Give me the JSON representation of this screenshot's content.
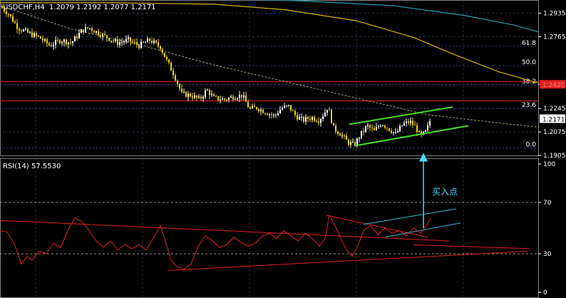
{
  "main_header": {
    "symbol": "USDCHF,H4",
    "ohlc": "1.2079 1.2192 1.2077 1.2171"
  },
  "rsi_header": {
    "label": "RSI(14) 57.5530"
  },
  "annotation": {
    "buy_point": "买入点"
  },
  "colors": {
    "background": "#000000",
    "grid": "#3a4a6a",
    "up_candle": "#ffffff",
    "down_candle": "#f0d000",
    "ma_fast": "#a8a070",
    "ma_mid": "#d4b400",
    "ma_slow": "#20a0b0",
    "red_lines": "#e02020",
    "channel_green": "#40e020",
    "channel_cyan": "#30b8e0",
    "rsi_line": "#e02020",
    "arrow": "#40e0ff",
    "current_price_box": "#ffffff",
    "level_box": "#e02020"
  },
  "chart_data": [
    {
      "type": "candlestick",
      "title": "USDCHF,H4",
      "ylim": [
        1.1905,
        1.302
      ],
      "y_ticks": [
        "1.2935",
        "1.2765",
        "1.2420",
        "1.2245",
        "1.2075",
        "1.1905"
      ],
      "current_price": "1.2171",
      "highlighted_level": "1.2420",
      "fib_levels": [
        {
          "label": "61.8",
          "value": 1.2695
        },
        {
          "label": "50.0",
          "value": 1.2555
        },
        {
          "label": "38.2",
          "value": 1.2415
        },
        {
          "label": "23.6",
          "value": 1.2245
        },
        {
          "label": "0.0",
          "value": 1.196
        }
      ],
      "horizontal_lines": [
        1.244,
        1.23
      ],
      "close_path": [
        [
          0,
          1.2985
        ],
        [
          12,
          1.293
        ],
        [
          25,
          1.283
        ],
        [
          40,
          1.279
        ],
        [
          55,
          1.276
        ],
        [
          70,
          1.27
        ],
        [
          85,
          1.274
        ],
        [
          100,
          1.272
        ],
        [
          115,
          1.281
        ],
        [
          125,
          1.283
        ],
        [
          135,
          1.28
        ],
        [
          150,
          1.276
        ],
        [
          165,
          1.272
        ],
        [
          180,
          1.274
        ],
        [
          195,
          1.27
        ],
        [
          210,
          1.274
        ],
        [
          225,
          1.269
        ],
        [
          235,
          1.258
        ],
        [
          245,
          1.248
        ],
        [
          255,
          1.235
        ],
        [
          268,
          1.234
        ],
        [
          280,
          1.231
        ],
        [
          290,
          1.238
        ],
        [
          300,
          1.232
        ],
        [
          315,
          1.231
        ],
        [
          328,
          1.233
        ],
        [
          340,
          1.234
        ],
        [
          350,
          1.224
        ],
        [
          360,
          1.225
        ],
        [
          372,
          1.222
        ],
        [
          385,
          1.219
        ],
        [
          395,
          1.225
        ],
        [
          405,
          1.226
        ],
        [
          415,
          1.219
        ],
        [
          425,
          1.216
        ],
        [
          437,
          1.218
        ],
        [
          447,
          1.216
        ],
        [
          455,
          1.221
        ],
        [
          460,
          1.226
        ],
        [
          468,
          1.21
        ],
        [
          478,
          1.206
        ],
        [
          488,
          1.2
        ],
        [
          497,
          1.198
        ],
        [
          505,
          1.205
        ],
        [
          515,
          1.212
        ],
        [
          525,
          1.208
        ],
        [
          535,
          1.214
        ],
        [
          545,
          1.21
        ],
        [
          555,
          1.206
        ],
        [
          565,
          1.213
        ],
        [
          575,
          1.215
        ],
        [
          583,
          1.211
        ],
        [
          590,
          1.204
        ],
        [
          598,
          1.208
        ],
        [
          604,
          1.2171
        ]
      ],
      "ma_fast_path": [
        [
          0,
          1.299
        ],
        [
          100,
          1.282
        ],
        [
          200,
          1.27
        ],
        [
          300,
          1.256
        ],
        [
          400,
          1.244
        ],
        [
          500,
          1.232
        ],
        [
          600,
          1.22
        ],
        [
          700,
          1.214
        ],
        [
          755,
          1.211
        ]
      ],
      "ma_mid_path": [
        [
          0,
          1.301
        ],
        [
          150,
          1.301
        ],
        [
          300,
          1.3
        ],
        [
          400,
          1.296
        ],
        [
          500,
          1.288
        ],
        [
          580,
          1.276
        ],
        [
          640,
          1.263
        ],
        [
          700,
          1.251
        ],
        [
          755,
          1.243
        ]
      ],
      "ma_slow_path": [
        [
          0,
          1.304
        ],
        [
          200,
          1.304
        ],
        [
          400,
          1.303
        ],
        [
          550,
          1.299
        ],
        [
          650,
          1.292
        ],
        [
          720,
          1.285
        ],
        [
          755,
          1.28
        ]
      ],
      "channel_upper": [
        [
          490,
          1.213
        ],
        [
          635,
          1.2255
        ]
      ],
      "channel_lower": [
        [
          498,
          1.1975
        ],
        [
          657,
          1.212
        ]
      ]
    },
    {
      "type": "line",
      "title": "RSI(14) 57.5530",
      "ylim": [
        0,
        100
      ],
      "y_ticks": [
        "100",
        "70",
        "30",
        "0"
      ],
      "reference_levels": [
        70,
        30
      ],
      "series": [
        {
          "values": [
            [
              0,
              48
            ],
            [
              10,
              47
            ],
            [
              20,
              38
            ],
            [
              30,
              22
            ],
            [
              38,
              28
            ],
            [
              45,
              25
            ],
            [
              55,
              32
            ],
            [
              65,
              30
            ],
            [
              75,
              38
            ],
            [
              85,
              35
            ],
            [
              95,
              48
            ],
            [
              105,
              58
            ],
            [
              115,
              55
            ],
            [
              125,
              48
            ],
            [
              135,
              40
            ],
            [
              145,
              35
            ],
            [
              155,
              40
            ],
            [
              165,
              33
            ],
            [
              175,
              37
            ],
            [
              185,
              34
            ],
            [
              195,
              37
            ],
            [
              205,
              33
            ],
            [
              215,
              42
            ],
            [
              225,
              52
            ],
            [
              232,
              40
            ],
            [
              240,
              25
            ],
            [
              248,
              20
            ],
            [
              258,
              18
            ],
            [
              268,
              22
            ],
            [
              278,
              36
            ],
            [
              288,
              44
            ],
            [
              298,
              40
            ],
            [
              308,
              35
            ],
            [
              318,
              37
            ],
            [
              328,
              43
            ],
            [
              338,
              39
            ],
            [
              348,
              36
            ],
            [
              358,
              38
            ],
            [
              368,
              44
            ],
            [
              378,
              46
            ],
            [
              388,
              42
            ],
            [
              398,
              48
            ],
            [
              408,
              44
            ],
            [
              418,
              40
            ],
            [
              428,
              46
            ],
            [
              438,
              42
            ],
            [
              448,
              36
            ],
            [
              456,
              42
            ],
            [
              462,
              60
            ],
            [
              470,
              52
            ],
            [
              478,
              42
            ],
            [
              486,
              33
            ],
            [
              494,
              28
            ],
            [
              502,
              36
            ],
            [
              510,
              48
            ],
            [
              520,
              52
            ],
            [
              530,
              45
            ],
            [
              540,
              50
            ],
            [
              550,
              46
            ],
            [
              560,
              48
            ],
            [
              570,
              44
            ],
            [
              580,
              50
            ],
            [
              590,
              46
            ],
            [
              598,
              52
            ],
            [
              604,
              57.55
            ]
          ]
        }
      ],
      "red_upper_trend": [
        [
          0,
          56
        ],
        [
          630,
          40
        ]
      ],
      "red_lower_trend": [
        [
          235,
          17
        ],
        [
          740,
          32
        ]
      ],
      "red_top_line": [
        [
          458,
          60
        ],
        [
          600,
          43
        ]
      ],
      "red_bottom_line": [
        [
          580,
          37
        ],
        [
          742,
          34
        ]
      ],
      "cyan_upper": [
        [
          510,
          53
        ],
        [
          640,
          65
        ]
      ],
      "cyan_lower": [
        [
          540,
          43
        ],
        [
          646,
          54
        ]
      ]
    }
  ]
}
